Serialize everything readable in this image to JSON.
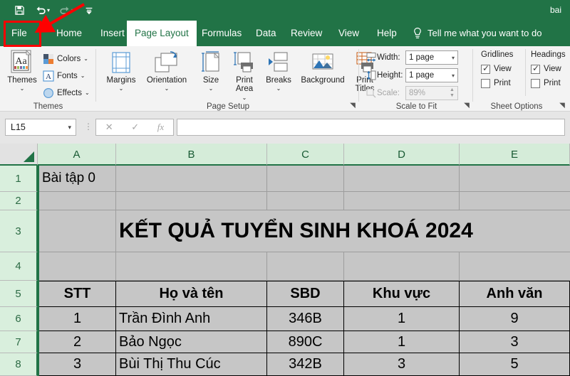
{
  "window": {
    "document_title": "bai",
    "quick_access": [
      {
        "name": "save-icon",
        "label": "Save"
      },
      {
        "name": "undo-icon",
        "label": "Undo"
      },
      {
        "name": "redo-icon",
        "label": "Redo"
      },
      {
        "name": "customize-qat-icon",
        "label": "Customize Quick Access Toolbar"
      }
    ]
  },
  "ribbon": {
    "tabs": [
      {
        "label": "File",
        "active": false
      },
      {
        "label": "Home",
        "active": false
      },
      {
        "label": "Insert",
        "active": false
      },
      {
        "label": "Page Layout",
        "active": true
      },
      {
        "label": "Formulas",
        "active": false
      },
      {
        "label": "Data",
        "active": false
      },
      {
        "label": "Review",
        "active": false
      },
      {
        "label": "View",
        "active": false
      },
      {
        "label": "Help",
        "active": false
      }
    ],
    "tell_me": "Tell me what you want to do",
    "groups": {
      "themes": {
        "label": "Themes",
        "big_button": {
          "label": "Themes"
        },
        "items": [
          {
            "label": "Colors"
          },
          {
            "label": "Fonts"
          },
          {
            "label": "Effects"
          }
        ]
      },
      "page_setup": {
        "label": "Page Setup",
        "items": [
          {
            "label": "Margins",
            "dropdown": true
          },
          {
            "label": "Orientation",
            "dropdown": true
          },
          {
            "label": "Size",
            "dropdown": true
          },
          {
            "label": "Print Area",
            "dropdown": true
          },
          {
            "label": "Breaks",
            "dropdown": true
          },
          {
            "label": "Background",
            "dropdown": false
          },
          {
            "label": "Print Titles",
            "dropdown": false
          }
        ]
      },
      "scale_to_fit": {
        "label": "Scale to Fit",
        "width_label": "Width:",
        "width_value": "1 page",
        "height_label": "Height:",
        "height_value": "1 page",
        "scale_label": "Scale:",
        "scale_value": "89%"
      },
      "sheet_options": {
        "label": "Sheet Options",
        "gridlines_label": "Gridlines",
        "headings_label": "Headings",
        "gridlines_view": "View",
        "gridlines_view_checked": true,
        "gridlines_print": "Print",
        "gridlines_print_checked": false,
        "headings_view": "View",
        "headings_view_checked": true,
        "headings_print": "Print",
        "headings_print_checked": false
      }
    }
  },
  "formula_bar": {
    "name_box_value": "L15",
    "cancel_icon": "✕",
    "enter_icon": "✓",
    "function_icon": "fx",
    "input_value": ""
  },
  "sheet": {
    "column_headers": [
      "A",
      "B",
      "C",
      "D",
      "E"
    ],
    "row_headers": [
      "1",
      "2",
      "3",
      "4",
      "5",
      "6",
      "7",
      "8"
    ],
    "cells": {
      "A1": "Bài tập 0",
      "title_row3": "KẾT QUẢ TUYỂN SINH KHOÁ 2024",
      "header_row": [
        "STT",
        "Họ và tên",
        "SBD",
        "Khu vực",
        "Anh văn"
      ],
      "data_rows": [
        [
          "1",
          "Trần Đình Anh",
          "346B",
          "1",
          "9"
        ],
        [
          "2",
          "Bảo Ngọc",
          "890C",
          "1",
          "3"
        ],
        [
          "3",
          "Bùi Thị Thu Cúc",
          "342B",
          "3",
          "5"
        ]
      ]
    }
  },
  "annotations": {
    "highlight_target": "File",
    "highlight_color": "#ff0000",
    "arrow_color": "#ff0000"
  },
  "colors": {
    "excel_green": "#217346",
    "ribbon_bg": "#f3f3f3",
    "selection_gray": "#c6c6c6",
    "header_green": "#d5ecd9"
  }
}
